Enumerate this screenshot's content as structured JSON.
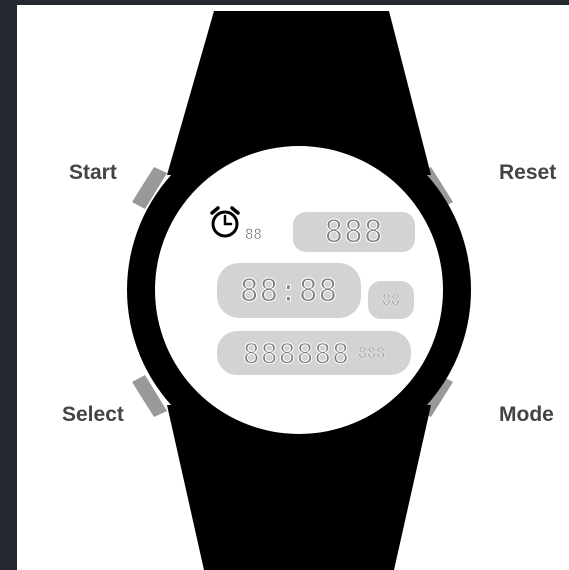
{
  "buttons": {
    "start": "Start",
    "reset": "Reset",
    "select": "Select",
    "mode": "Mode"
  },
  "display": {
    "alarm_digits": "88",
    "top_value": "888",
    "time_value": "88:88",
    "seconds_value": "88",
    "counter_value": "888888",
    "counter_small": "888"
  },
  "icons": {
    "alarm": "alarm-clock-icon"
  },
  "colors": {
    "background": "#252830",
    "strap": "#000000",
    "face": "#ffffff",
    "lcd_panel": "#d3d3d3",
    "lcd_segment": "#808080",
    "side_button": "#999999",
    "label": "#444444"
  }
}
